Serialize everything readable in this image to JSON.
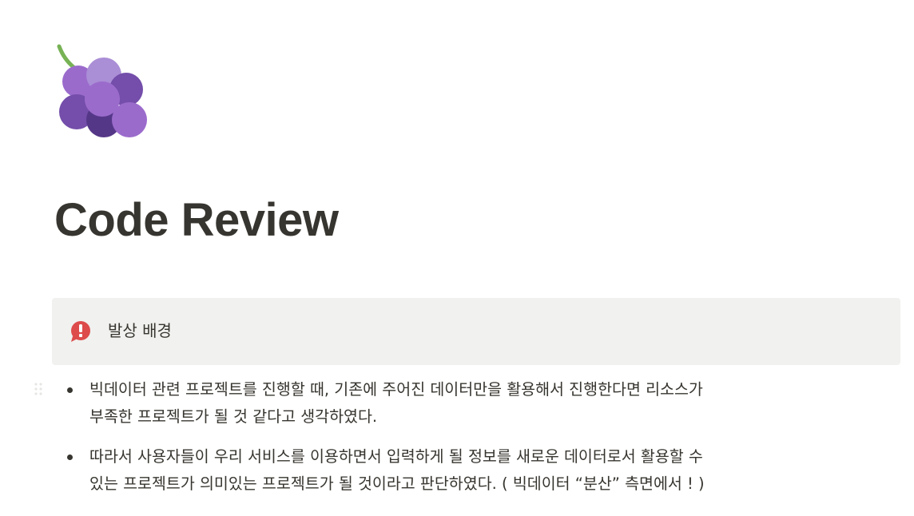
{
  "page": {
    "icon": "grapes-emoji",
    "title": "Code Review"
  },
  "callout": {
    "icon": "exclamation-speech-bubble-icon",
    "icon_color": "#dd4b4b",
    "background": "#f1f1ef",
    "text": "발상 배경"
  },
  "bullets": [
    {
      "line1": "빅데이터 관련 프로젝트를 진행할 때, 기존에 주어진 데이터만을 활용해서 진행한다면 리소스가",
      "line2": "부족한 프로젝트가 될 것 같다고 생각하였다."
    },
    {
      "line1": "따라서 사용자들이 우리 서비스를 이용하면서 입력하게 될 정보를 새로운 데이터로서 활용할 수",
      "line2": "있는 프로젝트가 의미있는 프로젝트가 될 것이라고 판단하였다. ( 빅데이터 “분산” 측면에서 ! )"
    }
  ]
}
